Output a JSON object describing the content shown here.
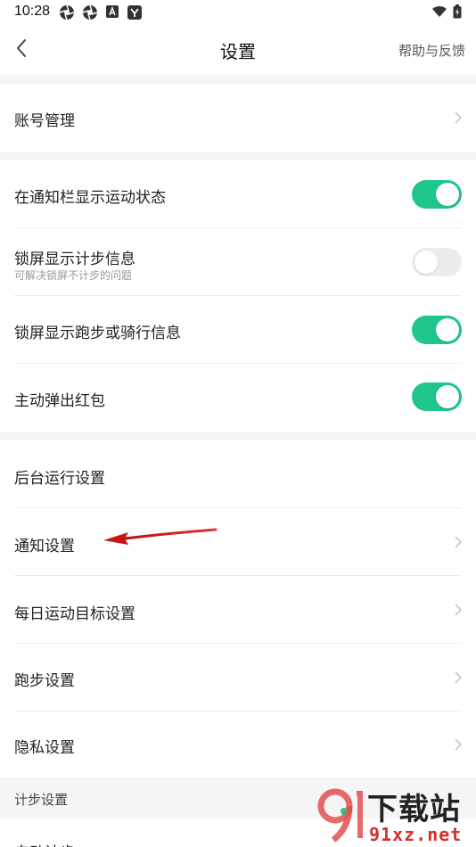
{
  "status_bar": {
    "time": "10:28",
    "left_icons": [
      "aperture-icon",
      "aperture-icon",
      "a-square-icon",
      "app-y-icon"
    ],
    "right_icons": [
      "wifi-icon",
      "battery-charging-icon"
    ]
  },
  "header": {
    "title": "设置",
    "help_label": "帮助与反馈"
  },
  "sections": {
    "account": {
      "label": "账号管理"
    },
    "toggles": [
      {
        "label": "在通知栏显示运动状态",
        "sublabel": "",
        "on": true
      },
      {
        "label": "锁屏显示计步信息",
        "sublabel": "可解决锁屏不计步的问题",
        "on": false
      },
      {
        "label": "锁屏显示跑步或骑行信息",
        "sublabel": "",
        "on": true
      },
      {
        "label": "主动弹出红包",
        "sublabel": "",
        "on": true
      }
    ],
    "settings": [
      {
        "label": "后台运行设置"
      },
      {
        "label": "通知设置"
      },
      {
        "label": "每日运动目标设置"
      },
      {
        "label": "跑步设置"
      },
      {
        "label": "隐私设置"
      }
    ],
    "step_header": {
      "label": "计步设置"
    },
    "partial_row": {
      "label": "自动计步"
    }
  },
  "watermark": {
    "text": "下载站",
    "url_text": "91xz.net"
  },
  "colors": {
    "accent": "#1fc68a",
    "background_gap": "#f5f5f7",
    "annotation_arrow": "#d42020"
  }
}
